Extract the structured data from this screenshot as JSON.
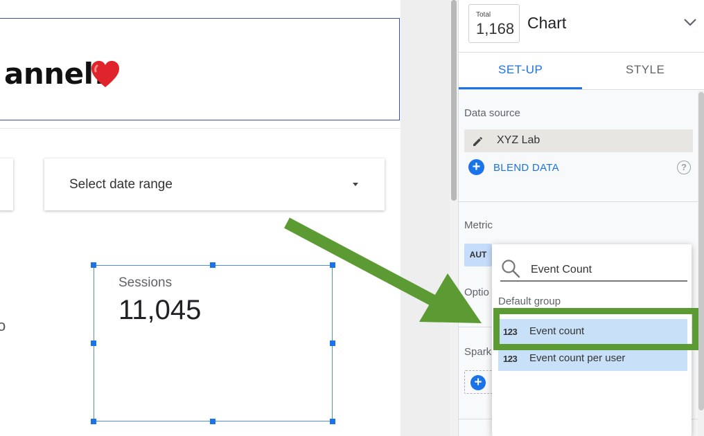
{
  "report": {
    "title": "annel!",
    "date_range_placeholder": "Select date range",
    "stray_mark": "o",
    "scorecard": {
      "label": "Sessions",
      "value": "11,045"
    }
  },
  "panel": {
    "thumbnail": {
      "small_label": "Total",
      "big_value": "1,168"
    },
    "chart_type": "Chart",
    "tabs": [
      {
        "label": "SET-UP",
        "active": true
      },
      {
        "label": "STYLE",
        "active": false
      }
    ],
    "data_source": {
      "title": "Data source",
      "name": "XYZ Lab",
      "blend_label": "BLEND DATA"
    },
    "metric": {
      "title": "Metric",
      "chip_label": "AUT",
      "optional_title": "Optio",
      "sparkline_title": "Spark"
    }
  },
  "picker": {
    "search_value": "Event Count",
    "group_label": "Default group",
    "options": [
      {
        "icon": "123",
        "label": "Event count"
      },
      {
        "icon": "123",
        "label": "Event count per user"
      }
    ]
  },
  "colors": {
    "accent": "#1a73e8",
    "highlight": "#5c9a33",
    "selected_bg": "#c8e1f8"
  },
  "icons": [
    "heart-icon",
    "pencil-icon",
    "plus-icon",
    "help-icon",
    "search-icon",
    "chevron-down-icon",
    "number-type-icon",
    "arrow-annotation"
  ]
}
